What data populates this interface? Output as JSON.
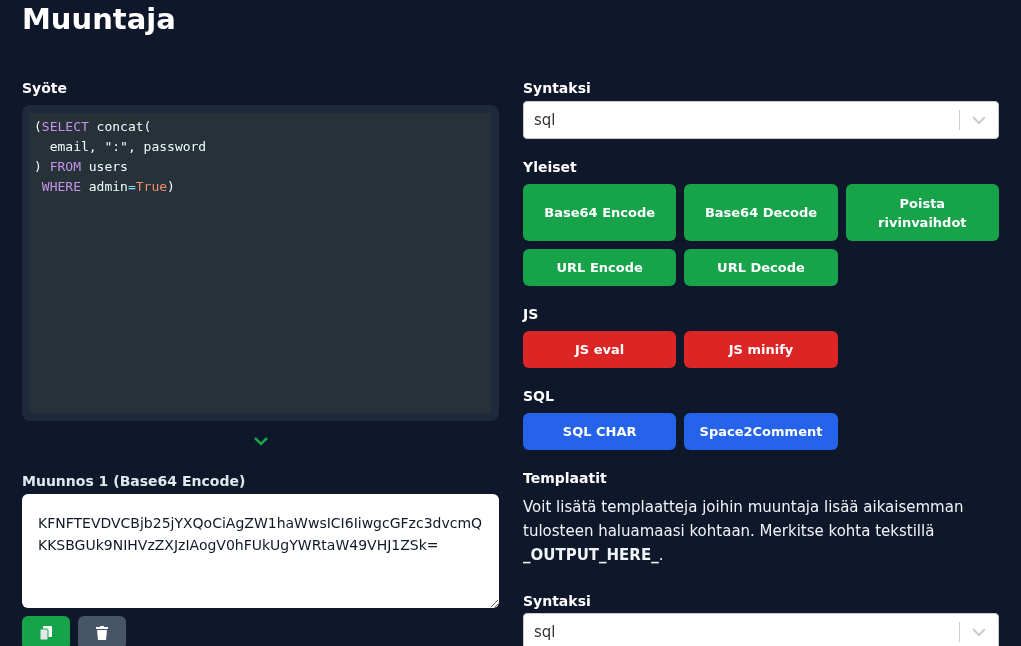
{
  "title": "Muuntaja",
  "input": {
    "label": "Syöte",
    "code_lines": [
      [
        {
          "text": "(",
          "kind": "plain"
        },
        {
          "text": "SELECT",
          "kind": "keyword"
        },
        {
          "text": " concat(",
          "kind": "plain"
        }
      ],
      [
        {
          "text": "  email, \":\", password",
          "kind": "plain"
        }
      ],
      [
        {
          "text": ") ",
          "kind": "plain"
        },
        {
          "text": "FROM",
          "kind": "keyword"
        },
        {
          "text": " users",
          "kind": "plain"
        }
      ],
      [
        {
          "text": " WHERE",
          "kind": "keyword"
        },
        {
          "text": " admin",
          "kind": "plain"
        },
        {
          "text": "=",
          "kind": "operator"
        },
        {
          "text": "True",
          "kind": "literal"
        },
        {
          "text": ")",
          "kind": "plain"
        }
      ]
    ]
  },
  "transforms": [
    {
      "label": "Muunnos 1 (Base64 Encode)",
      "value": "KFNFTEVDVCBjb25jYXQoCiAgZW1haWwsICI6IiwgcGFzc3dvcmQKKSBGUk9NIHVzZXJzIAogV0hFUkUgYWRtaW49VHJ1ZSk="
    }
  ],
  "syntax": {
    "label": "Syntaksi",
    "value": "sql"
  },
  "groups": [
    {
      "title": "Yleiset",
      "color": "#16a34a",
      "buttons": [
        "Base64 Encode",
        "Base64 Decode",
        "Poista rivinvaihdot",
        "URL Encode",
        "URL Decode"
      ]
    },
    {
      "title": "JS",
      "color": "#dc2626",
      "buttons": [
        "JS eval",
        "JS minify"
      ]
    },
    {
      "title": "SQL",
      "color": "#2563eb",
      "buttons": [
        "SQL CHAR",
        "Space2Comment"
      ]
    }
  ],
  "templates": {
    "title": "Templaatit",
    "text": "Voit lisätä templaatteja joihin muuntaja lisää aikaisemman tulosteen haluamaasi kohtaan. Merkitse kohta tekstillä **_OUTPUT_HERE_**.",
    "syntax_label": "Syntaksi",
    "syntax_value": "sql"
  }
}
